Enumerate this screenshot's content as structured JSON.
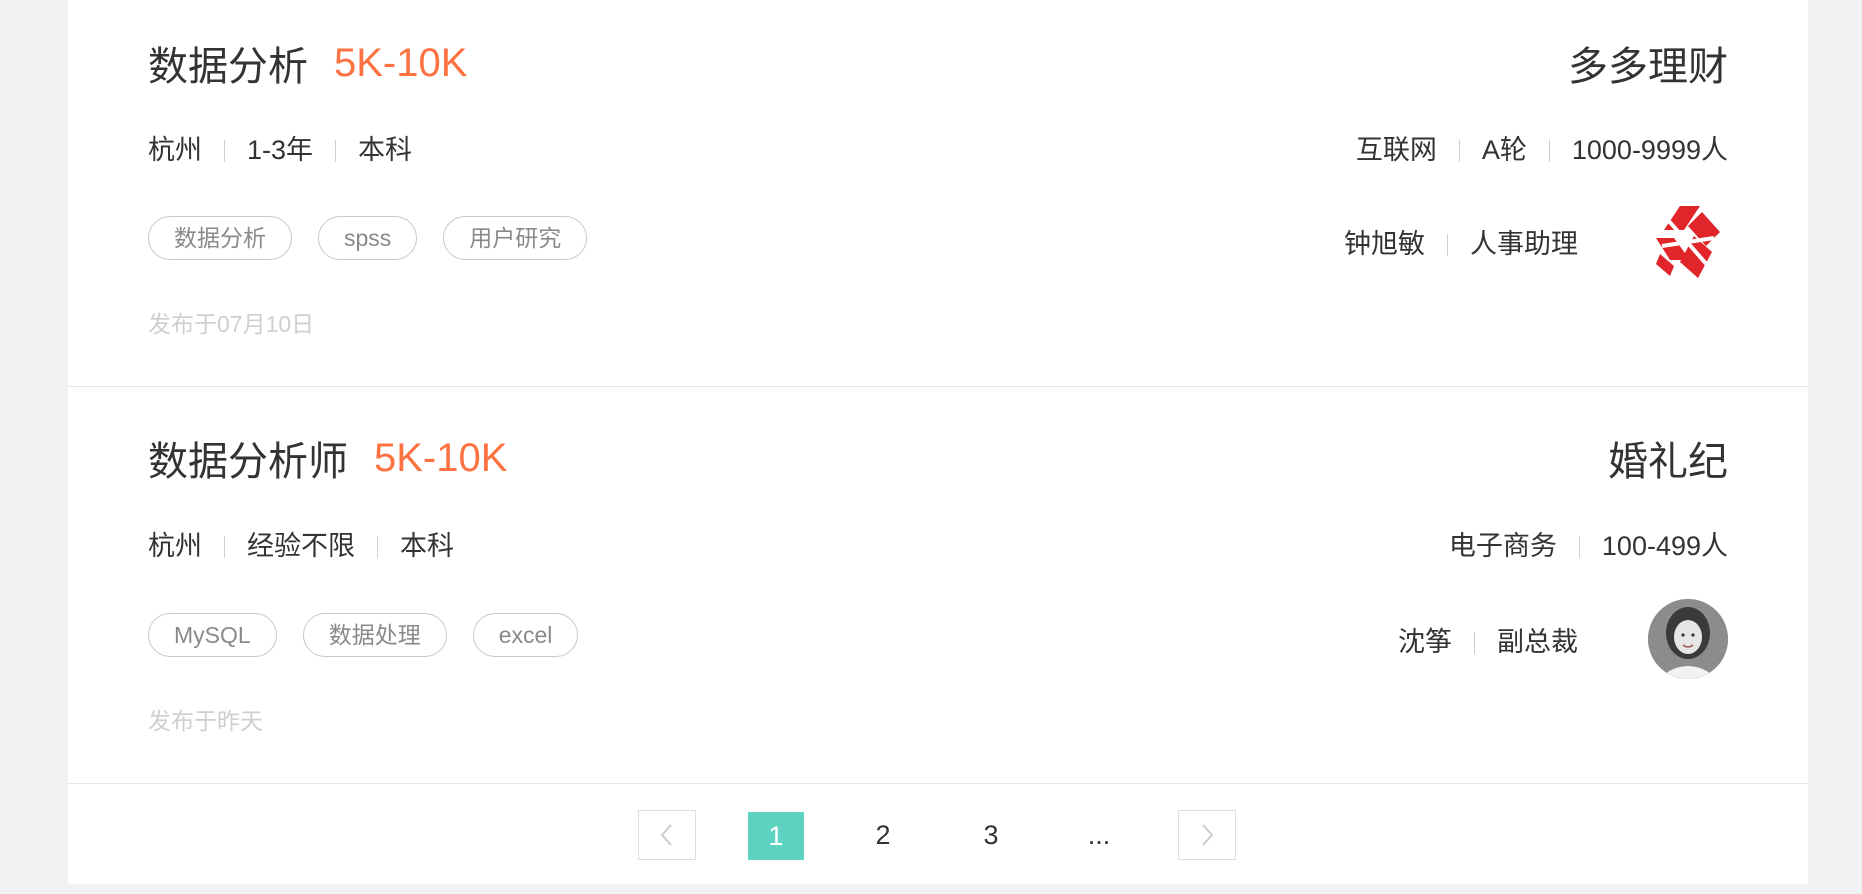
{
  "jobs": [
    {
      "title": "数据分析",
      "salary": "5K-10K",
      "meta": [
        "杭州",
        "1-3年",
        "本科"
      ],
      "tags": [
        "数据分析",
        "spss",
        "用户研究"
      ],
      "posted": "发布于07月10日",
      "company": {
        "name": "多多理财",
        "meta": [
          "互联网",
          "A轮",
          "1000-9999人"
        ],
        "recruiter_name": "钟旭敏",
        "recruiter_role": "人事助理",
        "logo": "red-diamond-logo"
      }
    },
    {
      "title": "数据分析师",
      "salary": "5K-10K",
      "meta": [
        "杭州",
        "经验不限",
        "本科"
      ],
      "tags": [
        "MySQL",
        "数据处理",
        "excel"
      ],
      "posted": "发布于昨天",
      "company": {
        "name": "婚礼纪",
        "meta": [
          "电子商务",
          "100-499人"
        ],
        "recruiter_name": "沈筝",
        "recruiter_role": "副总裁",
        "logo": "person-avatar"
      }
    }
  ],
  "pagination": {
    "prev_icon": "chevron-left-icon",
    "pages": [
      "1",
      "2",
      "3",
      "..."
    ],
    "active": "1",
    "next_icon": "chevron-right-icon"
  },
  "colors": {
    "salary": "#fd7240",
    "active_page": "#5fd3c2",
    "logo_red": "#e0252b"
  }
}
